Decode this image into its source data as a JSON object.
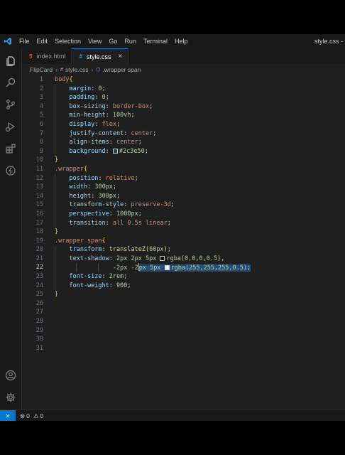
{
  "menu": [
    "File",
    "Edit",
    "Selection",
    "View",
    "Go",
    "Run",
    "Terminal",
    "Help"
  ],
  "window_title": "style.css - fli",
  "tabs": [
    {
      "name": "index.html",
      "icon": "html-file-icon",
      "active": false
    },
    {
      "name": "style.css",
      "icon": "css-file-icon",
      "active": true,
      "close": "×"
    }
  ],
  "breadcrumb": {
    "folder": "FlipCard",
    "file": "style.css",
    "selector": ".wrapper span"
  },
  "editor": {
    "current_line": 22,
    "line_numbers": [
      "1",
      "2",
      "3",
      "4",
      "5",
      "6",
      "7",
      "8",
      "9",
      "10",
      "11",
      "12",
      "13",
      "14",
      "15",
      "16",
      "17",
      "18",
      "19",
      "20",
      "21",
      "22",
      "23",
      "24",
      "25",
      "26",
      "27",
      "28",
      "29",
      "30",
      "31"
    ],
    "l1": {
      "sel": "body",
      "brace": "{"
    },
    "l2": {
      "prop": "margin",
      "val": "0"
    },
    "l3": {
      "prop": "padding",
      "val": "0"
    },
    "l4": {
      "prop": "box-sizing",
      "val": "border-box"
    },
    "l5": {
      "prop": "min-height",
      "val": "100vh"
    },
    "l6": {
      "prop": "display",
      "val": "flex"
    },
    "l7": {
      "prop": "justify-content",
      "val": "center"
    },
    "l8": {
      "prop": "align-items",
      "val": "center"
    },
    "l9": {
      "prop": "background",
      "val": "#2c3e50",
      "swatch": "#2c3e50"
    },
    "l10": {
      "brace": "}"
    },
    "l11": {
      "sel": ".wrapper",
      "brace": "{"
    },
    "l12": {
      "prop": "position",
      "val": "relative"
    },
    "l13": {
      "prop": "width",
      "val": "300px"
    },
    "l14": {
      "prop": "height",
      "val": "300px"
    },
    "l15": {
      "prop": "transform-style",
      "val": "preserve-3d"
    },
    "l16": {
      "prop": "perspective",
      "val": "1000px"
    },
    "l17": {
      "prop": "transition",
      "val": "all 0.5s linear"
    },
    "l18": {
      "brace": "}"
    },
    "l19": {
      "sel": ".wrapper span",
      "brace": "{"
    },
    "l20": {
      "prop": "transform",
      "fn": "translateZ",
      "arg": "60px"
    },
    "l21": {
      "prop": "text-shadow",
      "pre": "2px 2px 5px ",
      "color": "rgba(0,0,0,0.5)",
      "swatch": "#000000"
    },
    "l22": {
      "pre": "-2px -2",
      "sel_pre": "px 5px ",
      "color": "rgba(255,255,255,0.5)",
      "swatch": "#ffffff"
    },
    "l23": {
      "prop": "font-size",
      "val": "2rem"
    },
    "l24": {
      "prop": "font-weight",
      "val": "900"
    },
    "l25": {
      "brace": "}"
    }
  },
  "status": {
    "remote_icon": "remote-icon",
    "errors": "0",
    "warnings": "0"
  },
  "colors": {
    "accent": "#0078d4",
    "editor_bg": "#1f1f1f",
    "selection": "#264f78"
  }
}
